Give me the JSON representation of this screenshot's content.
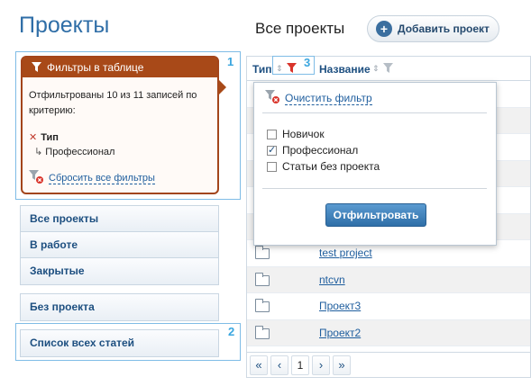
{
  "page_title": "Проекты",
  "filters_panel": {
    "header": "Фильтры в таблице",
    "description": "Отфильтрованы 10 из 11 записей по критерию:",
    "criterion": "Тип",
    "criterion_value": "Профессионал",
    "reset_label": "Сбросить все фильтры"
  },
  "nav": {
    "group1": [
      "Все проекты",
      "В работе",
      "Закрытые"
    ],
    "no_project": "Без проекта",
    "all_articles": "Список всех статей"
  },
  "callouts": {
    "one": "1",
    "two": "2",
    "three": "3"
  },
  "main": {
    "title": "Все проекты",
    "add_button": "Добавить проект"
  },
  "table": {
    "col_type": "Тип",
    "col_name": "Название",
    "rows": [
      "",
      "",
      "",
      "",
      "",
      "",
      "test project",
      "ntcvn",
      "Проект3",
      "Проект2"
    ],
    "pager": {
      "first": "«",
      "prev": "‹",
      "page": "1",
      "next": "›",
      "last": "»"
    }
  },
  "dropdown": {
    "clear_label": "Очистить фильтр",
    "options": [
      {
        "label": "Новичок",
        "checked": false
      },
      {
        "label": "Профессионал",
        "checked": true
      },
      {
        "label": "Статьи без проекта",
        "checked": false
      }
    ],
    "apply_label": "Отфильтровать"
  },
  "colors": {
    "accent": "#2f6ea7",
    "filter_header": "#a84918",
    "callout": "#3aa6df"
  }
}
